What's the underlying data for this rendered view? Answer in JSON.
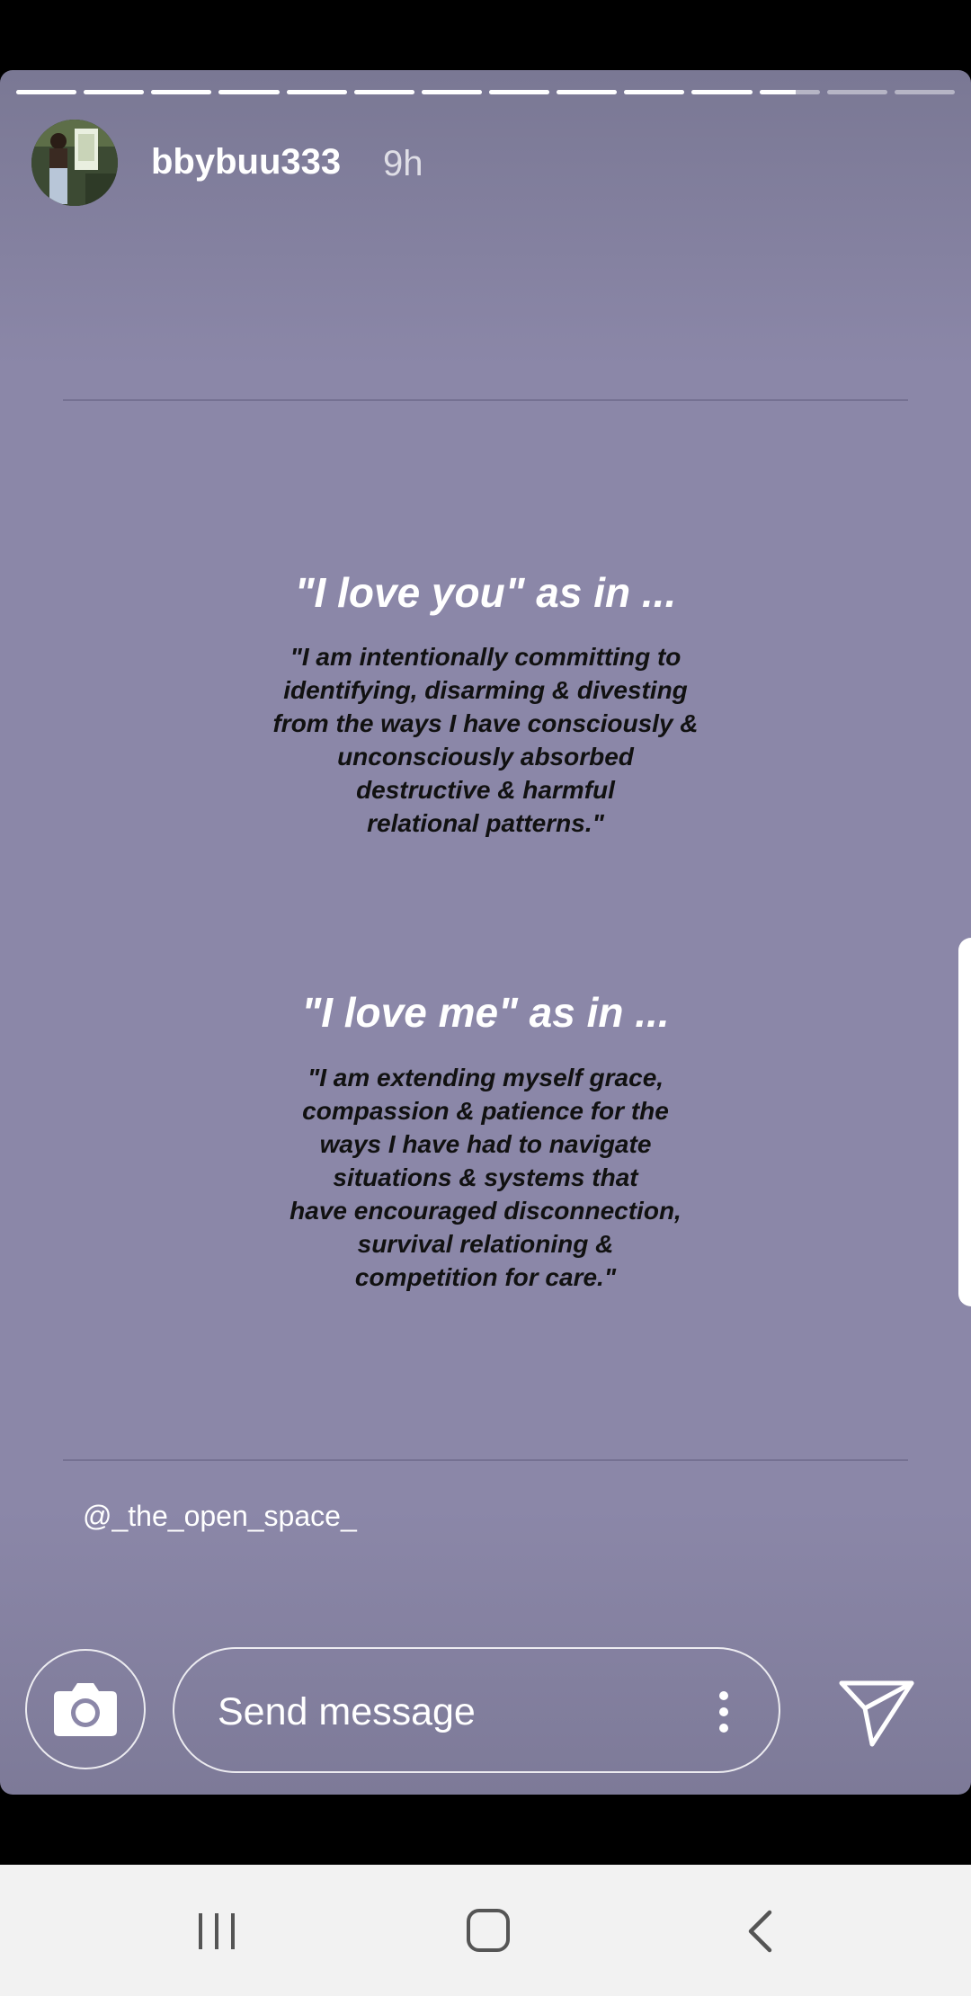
{
  "story": {
    "username": "bbybuu333",
    "time_ago": "9h",
    "progress": {
      "segments_total": 14,
      "segments_viewed": 11,
      "current_segment_fraction": 0.6
    }
  },
  "quotes": [
    {
      "heading": "\"I love you\" as in ...",
      "lines": [
        "\"I am intentionally committing to",
        "identifying, disarming & divesting",
        "from the ways I have consciously &",
        "unconsciously absorbed",
        "destructive & harmful",
        "relational patterns.\""
      ]
    },
    {
      "heading": "\"I love me\" as in ...",
      "lines": [
        "\"I am extending myself grace,",
        "compassion & patience for the",
        "ways I have had to navigate",
        "situations & systems that",
        "have encouraged disconnection,",
        "survival relationing &",
        "competition for care.\""
      ]
    }
  ],
  "mention": "@_the_open_space_",
  "reply_bar": {
    "placeholder": "Send message",
    "camera_icon": "camera-icon",
    "more_icon": "more-vertical-icon",
    "send_icon": "send-icon"
  },
  "nav_bar": {
    "recents_icon": "recents-icon",
    "home_icon": "home-icon",
    "back_icon": "back-icon"
  },
  "colors": {
    "story_background": "#8b87a8",
    "quote_heading": "#ffffff",
    "quote_body": "#111111",
    "nav_background": "#f2f2f2"
  }
}
